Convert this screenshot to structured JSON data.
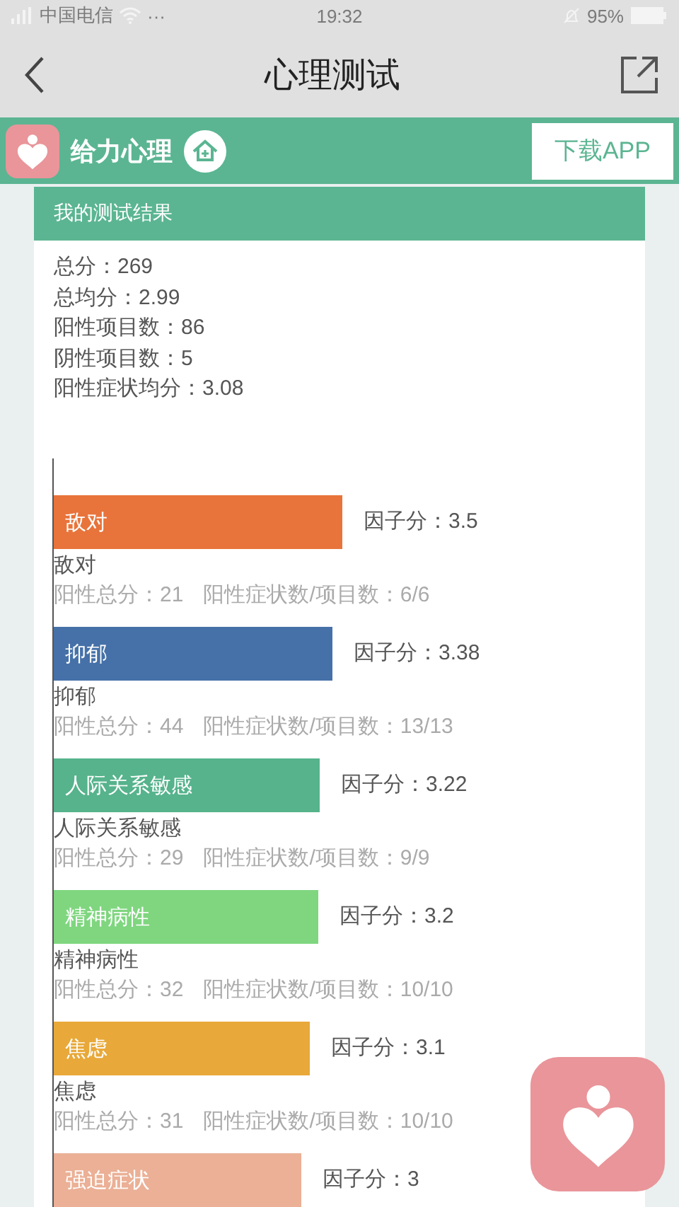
{
  "status_bar": {
    "carrier": "中国电信",
    "more": "···",
    "time": "19:32",
    "battery_text": "95%"
  },
  "nav": {
    "title": "心理测试"
  },
  "banner": {
    "brand": "给力心理",
    "download": "下载APP"
  },
  "card": {
    "title": "我的测试结果",
    "stats": [
      "总分：269",
      "总均分：2.99",
      "阳性项目数：86",
      "阴性项目数：5",
      "阳性症状均分：3.08"
    ],
    "chart_data": {
      "type": "bar",
      "orientation": "horizontal",
      "value_labels": [
        "因子分：3.5",
        "因子分：3.38",
        "因子分：3.22",
        "因子分：3.2",
        "因子分：3.1",
        "因子分：3"
      ],
      "categories": [
        "敌对",
        "抑郁",
        "人际关系敏感",
        "精神病性",
        "焦虑",
        "强迫症状"
      ],
      "values": [
        3.5,
        3.38,
        3.22,
        3.2,
        3.1,
        3
      ]
    },
    "factors": [
      {
        "color": "#e8743b",
        "caption": "敌对",
        "total": "阳性总分：21",
        "ratio": "阳性症状数/项目数：6/6"
      },
      {
        "color": "#4671a8",
        "caption": "抑郁",
        "total": "阳性总分：44",
        "ratio": "阳性症状数/项目数：13/13"
      },
      {
        "color": "#56b38c",
        "caption": "人际关系敏感",
        "total": "阳性总分：29",
        "ratio": "阳性症状数/项目数：9/9"
      },
      {
        "color": "#7fd67f",
        "caption": "精神病性",
        "total": "阳性总分：32",
        "ratio": "阳性症状数/项目数：10/10"
      },
      {
        "color": "#e8a93a",
        "caption": "焦虑",
        "total": "阳性总分：31",
        "ratio": "阳性症状数/项目数：10/10"
      },
      {
        "color": "#ebb096"
      }
    ]
  }
}
